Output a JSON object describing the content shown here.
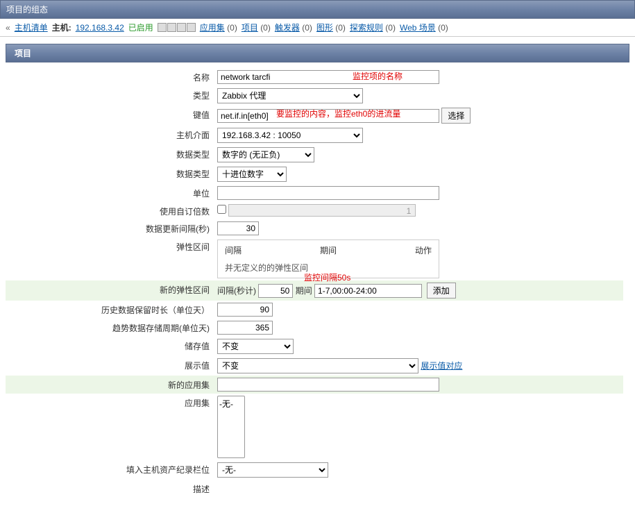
{
  "title_bar": "项目的组态",
  "breadcrumb": {
    "back_link": "主机清单",
    "host_label": "主机:",
    "host_ip": "192.168.3.42",
    "status": "已启用",
    "links": [
      {
        "label": "应用集",
        "count": "(0)"
      },
      {
        "label": "项目",
        "count": "(0)"
      },
      {
        "label": "触发器",
        "count": "(0)"
      },
      {
        "label": "图形",
        "count": "(0)"
      },
      {
        "label": "探索规则",
        "count": "(0)"
      },
      {
        "label": "Web 场景",
        "count": "(0)"
      }
    ]
  },
  "section_header": "项目",
  "annotations": {
    "name": "监控项的名称",
    "key": "要监控的内容，监控eth0的进流量",
    "interval": "监控间隔50s"
  },
  "form": {
    "name": {
      "label": "名称",
      "value": "network tarcfi"
    },
    "type": {
      "label": "类型",
      "value": "Zabbix 代理"
    },
    "key": {
      "label": "键值",
      "value": "net.if.in[eth0]",
      "button": "选择"
    },
    "interface": {
      "label": "主机介面",
      "value": "192.168.3.42 : 10050"
    },
    "data_type1": {
      "label": "数据类型",
      "value": "数字的 (无正负)"
    },
    "data_type2": {
      "label": "数据类型",
      "value": "十进位数字"
    },
    "unit": {
      "label": "单位",
      "value": ""
    },
    "use_multiplier": {
      "label": "使用自订倍数",
      "disabled_val": "1"
    },
    "update_interval": {
      "label": "数据更新间隔(秒)",
      "value": "30"
    },
    "flex_intervals": {
      "label": "弹性区间",
      "col_interval": "间隔",
      "col_period": "期间",
      "col_action": "动作",
      "empty": "并无定义的的弹性区间"
    },
    "new_flex": {
      "label": "新的弹性区间",
      "inline1": "间隔(秒计)",
      "val1": "50",
      "inline2": "期间",
      "val2": "1-7,00:00-24:00",
      "add_btn": "添加"
    },
    "history": {
      "label": "历史数据保留时长（单位天）",
      "value": "90"
    },
    "trends": {
      "label": "趋势数据存储周期(单位天)",
      "value": "365"
    },
    "store": {
      "label": "储存值",
      "value": "不变"
    },
    "show": {
      "label": "展示值",
      "value": "不变",
      "link": "展示值对应"
    },
    "new_app": {
      "label": "新的应用集",
      "value": ""
    },
    "apps": {
      "label": "应用集",
      "option": "-无-"
    },
    "inventory": {
      "label": "填入主机资产纪录栏位",
      "value": "-无-"
    },
    "description": {
      "label": "描述"
    }
  }
}
